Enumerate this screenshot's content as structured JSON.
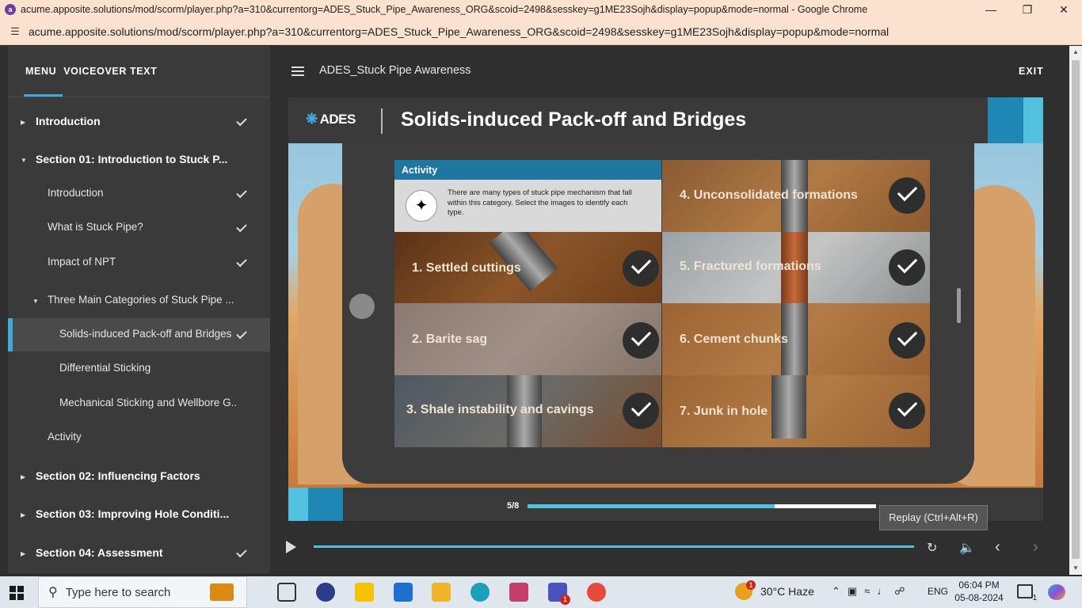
{
  "browser": {
    "window_title": "acume.apposite.solutions/mod/scorm/player.php?a=310&currentorg=ADES_Stuck_Pipe_Awareness_ORG&scoid=2498&sesskey=g1ME23Sojh&display=popup&mode=normal - Google Chrome",
    "url": "acume.apposite.solutions/mod/scorm/player.php?a=310&currentorg=ADES_Stuck_Pipe_Awareness_ORG&scoid=2498&sesskey=g1ME23Sojh&display=popup&mode=normal"
  },
  "sidebar": {
    "tabs": [
      {
        "label": "MENU"
      },
      {
        "label": "VOICEOVER TEXT"
      }
    ],
    "items": [
      {
        "label": "Introduction",
        "level": 0,
        "expanded": false,
        "checked": true
      },
      {
        "label": "Section 01: Introduction to Stuck P...",
        "level": 0,
        "expanded": true,
        "checked": false
      },
      {
        "label": "Introduction",
        "level": 1,
        "checked": true
      },
      {
        "label": "What is Stuck Pipe?",
        "level": 1,
        "checked": true
      },
      {
        "label": "Impact of NPT",
        "level": 1,
        "checked": true
      },
      {
        "label": "Three Main Categories of Stuck Pipe ...",
        "level": 1,
        "expanded": true,
        "checked": false
      },
      {
        "label": "Solids-induced Pack-off and Bridges",
        "level": 2,
        "checked": true,
        "selected": true
      },
      {
        "label": "Differential Sticking",
        "level": 2,
        "checked": false
      },
      {
        "label": "Mechanical Sticking and Wellbore G...",
        "level": 2,
        "checked": false
      },
      {
        "label": "Activity",
        "level": 1,
        "checked": false
      },
      {
        "label": "Section 02: Influencing Factors",
        "level": 0,
        "expanded": false,
        "checked": false
      },
      {
        "label": "Section 03: Improving Hole Conditi...",
        "level": 0,
        "expanded": false,
        "checked": false
      },
      {
        "label": "Section 04: Assessment",
        "level": 0,
        "expanded": false,
        "checked": true
      }
    ]
  },
  "header": {
    "course_title": "ADES_Stuck Pipe Awareness",
    "exit_label": "EXIT"
  },
  "slide": {
    "logo_text": "ADES",
    "title": "Solids-induced Pack-off and Bridges",
    "activity_heading": "Activity",
    "activity_text": "There are many types of stuck pipe mechanism that fall within this category. Select the images to identify each type.",
    "tiles": [
      {
        "label": "1. Settled cuttings",
        "checked": true
      },
      {
        "label": "2. Barite sag",
        "checked": true
      },
      {
        "label": "3. Shale instability and cavings",
        "checked": true
      },
      {
        "label": "4. Unconsolidated formations",
        "checked": true
      },
      {
        "label": "5. Fractured formations",
        "checked": true
      },
      {
        "label": "6. Cement chunks",
        "checked": true
      },
      {
        "label": "7. Junk in hole",
        "checked": true
      }
    ]
  },
  "player": {
    "progress_text": "5/8",
    "progress_fraction": 0.71,
    "replay_tooltip": "Replay (Ctrl+Alt+R)"
  },
  "taskbar": {
    "search_placeholder": "Type here to search",
    "weather": "30°C  Haze",
    "language": "ENG",
    "time": "06:04 PM",
    "date": "05-08-2024",
    "notification_count": "1",
    "weather_badge": "1",
    "teams_badge": "1"
  },
  "colors": {
    "accent": "#3fa9d8",
    "header_blue": "#1f76a0",
    "sidebar_bg": "#3a3a3a"
  }
}
